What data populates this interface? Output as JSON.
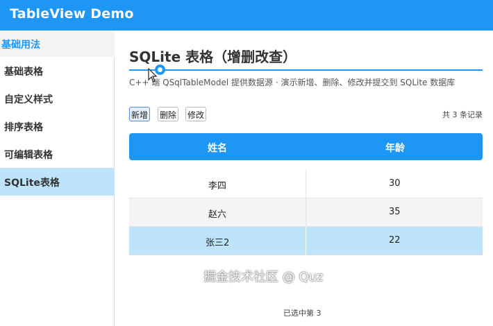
{
  "window": {
    "title": "TableView Demo"
  },
  "sidebar": {
    "group_label": "基础用法",
    "items": [
      {
        "label": "基础表格"
      },
      {
        "label": "自定义样式"
      },
      {
        "label": "排序表格"
      },
      {
        "label": "可编辑表格"
      },
      {
        "label": "SQLite表格",
        "active": true
      }
    ]
  },
  "main": {
    "title": "SQLite 表格（增删改查）",
    "description": "C++ 端 QSqlTableModel 提供数据源 · 演示新增、删除、修改并提交到 SQLite 数据库",
    "toolbar": {
      "add_label": "新增",
      "delete_label": "删除",
      "edit_label": "修改"
    },
    "record_count": "共 3 条记录",
    "table": {
      "columns": [
        "姓名",
        "年龄"
      ],
      "rows": [
        {
          "name": "李四",
          "age": "30"
        },
        {
          "name": "赵六",
          "age": "35"
        },
        {
          "name": "张三2",
          "age": "22",
          "selected": true
        }
      ]
    },
    "status_text": "已选中第 3"
  },
  "watermark": "掘金技术社区 @ Quz",
  "colors": {
    "accent": "#1e96f5",
    "selected_row": "#bde4fb",
    "alt_row": "#f4f4f4"
  }
}
